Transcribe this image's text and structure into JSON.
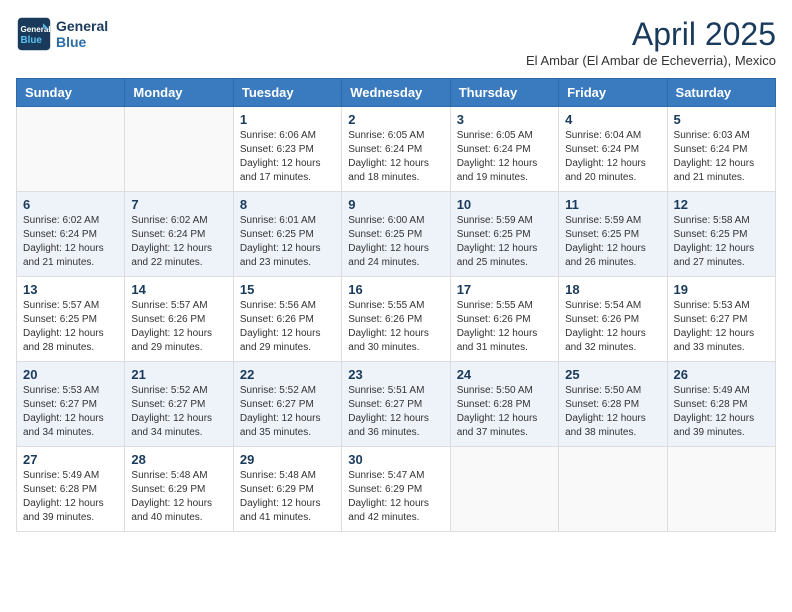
{
  "header": {
    "logo_line1": "General",
    "logo_line2": "Blue",
    "month_title": "April 2025",
    "subtitle": "El Ambar (El Ambar de Echeverria), Mexico"
  },
  "weekdays": [
    "Sunday",
    "Monday",
    "Tuesday",
    "Wednesday",
    "Thursday",
    "Friday",
    "Saturday"
  ],
  "weeks": [
    [
      {
        "day": "",
        "info": ""
      },
      {
        "day": "",
        "info": ""
      },
      {
        "day": "1",
        "info": "Sunrise: 6:06 AM\nSunset: 6:23 PM\nDaylight: 12 hours and 17 minutes."
      },
      {
        "day": "2",
        "info": "Sunrise: 6:05 AM\nSunset: 6:24 PM\nDaylight: 12 hours and 18 minutes."
      },
      {
        "day": "3",
        "info": "Sunrise: 6:05 AM\nSunset: 6:24 PM\nDaylight: 12 hours and 19 minutes."
      },
      {
        "day": "4",
        "info": "Sunrise: 6:04 AM\nSunset: 6:24 PM\nDaylight: 12 hours and 20 minutes."
      },
      {
        "day": "5",
        "info": "Sunrise: 6:03 AM\nSunset: 6:24 PM\nDaylight: 12 hours and 21 minutes."
      }
    ],
    [
      {
        "day": "6",
        "info": "Sunrise: 6:02 AM\nSunset: 6:24 PM\nDaylight: 12 hours and 21 minutes."
      },
      {
        "day": "7",
        "info": "Sunrise: 6:02 AM\nSunset: 6:24 PM\nDaylight: 12 hours and 22 minutes."
      },
      {
        "day": "8",
        "info": "Sunrise: 6:01 AM\nSunset: 6:25 PM\nDaylight: 12 hours and 23 minutes."
      },
      {
        "day": "9",
        "info": "Sunrise: 6:00 AM\nSunset: 6:25 PM\nDaylight: 12 hours and 24 minutes."
      },
      {
        "day": "10",
        "info": "Sunrise: 5:59 AM\nSunset: 6:25 PM\nDaylight: 12 hours and 25 minutes."
      },
      {
        "day": "11",
        "info": "Sunrise: 5:59 AM\nSunset: 6:25 PM\nDaylight: 12 hours and 26 minutes."
      },
      {
        "day": "12",
        "info": "Sunrise: 5:58 AM\nSunset: 6:25 PM\nDaylight: 12 hours and 27 minutes."
      }
    ],
    [
      {
        "day": "13",
        "info": "Sunrise: 5:57 AM\nSunset: 6:25 PM\nDaylight: 12 hours and 28 minutes."
      },
      {
        "day": "14",
        "info": "Sunrise: 5:57 AM\nSunset: 6:26 PM\nDaylight: 12 hours and 29 minutes."
      },
      {
        "day": "15",
        "info": "Sunrise: 5:56 AM\nSunset: 6:26 PM\nDaylight: 12 hours and 29 minutes."
      },
      {
        "day": "16",
        "info": "Sunrise: 5:55 AM\nSunset: 6:26 PM\nDaylight: 12 hours and 30 minutes."
      },
      {
        "day": "17",
        "info": "Sunrise: 5:55 AM\nSunset: 6:26 PM\nDaylight: 12 hours and 31 minutes."
      },
      {
        "day": "18",
        "info": "Sunrise: 5:54 AM\nSunset: 6:26 PM\nDaylight: 12 hours and 32 minutes."
      },
      {
        "day": "19",
        "info": "Sunrise: 5:53 AM\nSunset: 6:27 PM\nDaylight: 12 hours and 33 minutes."
      }
    ],
    [
      {
        "day": "20",
        "info": "Sunrise: 5:53 AM\nSunset: 6:27 PM\nDaylight: 12 hours and 34 minutes."
      },
      {
        "day": "21",
        "info": "Sunrise: 5:52 AM\nSunset: 6:27 PM\nDaylight: 12 hours and 34 minutes."
      },
      {
        "day": "22",
        "info": "Sunrise: 5:52 AM\nSunset: 6:27 PM\nDaylight: 12 hours and 35 minutes."
      },
      {
        "day": "23",
        "info": "Sunrise: 5:51 AM\nSunset: 6:27 PM\nDaylight: 12 hours and 36 minutes."
      },
      {
        "day": "24",
        "info": "Sunrise: 5:50 AM\nSunset: 6:28 PM\nDaylight: 12 hours and 37 minutes."
      },
      {
        "day": "25",
        "info": "Sunrise: 5:50 AM\nSunset: 6:28 PM\nDaylight: 12 hours and 38 minutes."
      },
      {
        "day": "26",
        "info": "Sunrise: 5:49 AM\nSunset: 6:28 PM\nDaylight: 12 hours and 39 minutes."
      }
    ],
    [
      {
        "day": "27",
        "info": "Sunrise: 5:49 AM\nSunset: 6:28 PM\nDaylight: 12 hours and 39 minutes."
      },
      {
        "day": "28",
        "info": "Sunrise: 5:48 AM\nSunset: 6:29 PM\nDaylight: 12 hours and 40 minutes."
      },
      {
        "day": "29",
        "info": "Sunrise: 5:48 AM\nSunset: 6:29 PM\nDaylight: 12 hours and 41 minutes."
      },
      {
        "day": "30",
        "info": "Sunrise: 5:47 AM\nSunset: 6:29 PM\nDaylight: 12 hours and 42 minutes."
      },
      {
        "day": "",
        "info": ""
      },
      {
        "day": "",
        "info": ""
      },
      {
        "day": "",
        "info": ""
      }
    ]
  ]
}
